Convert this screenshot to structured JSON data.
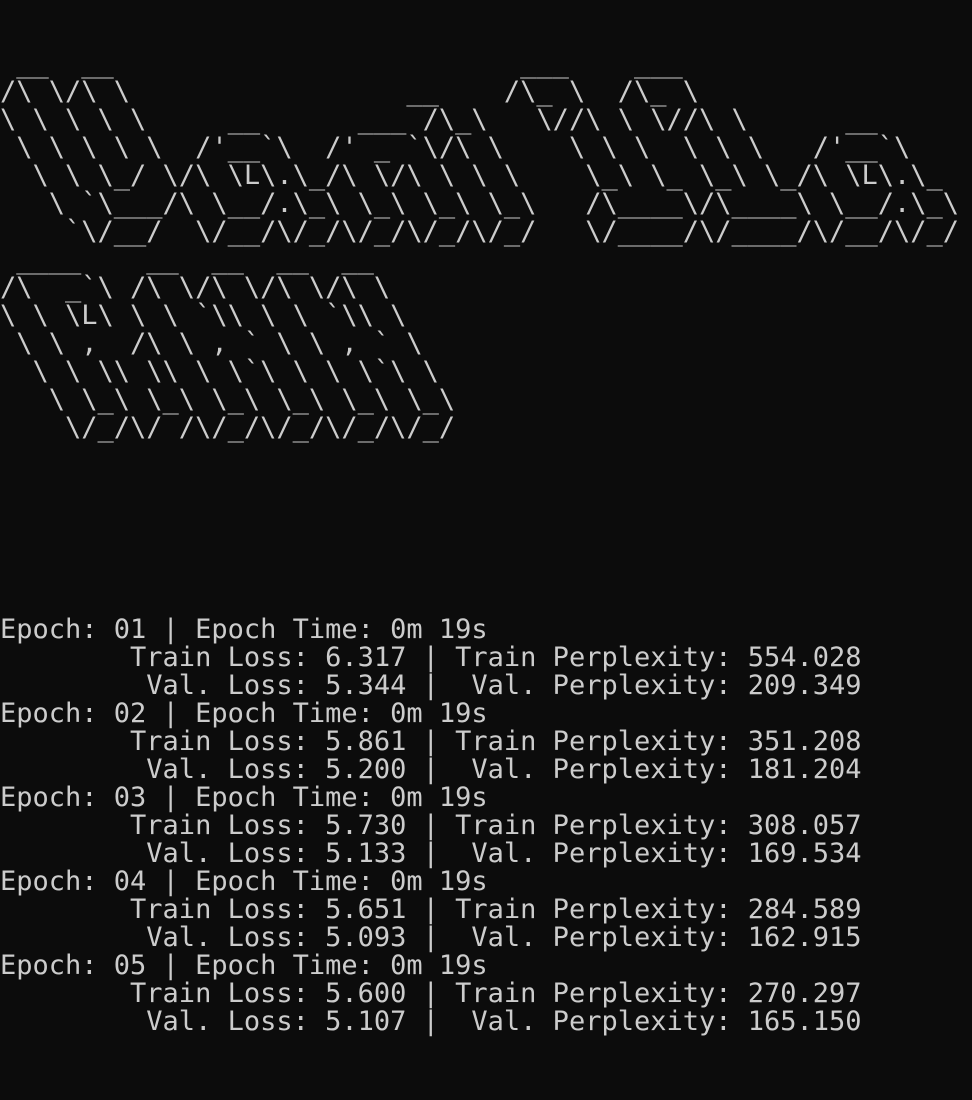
{
  "terminal": {
    "background": "#0c0c0c",
    "foreground": "#cccccc"
  },
  "banner": {
    "art": " __  __                         ___    ___              \n/\\ \\/\\ \\                 __    /\\_ \\  /\\_ \\             \n\\ \\ \\ \\ \\     __      ___ /\\_\\   \\//\\ \\ \\//\\ \\      __     \n \\ \\ \\ \\ \\  /'__`\\  /' _ `\\/\\ \\    \\ \\ \\  \\ \\ \\   /'__`\\   \n  \\ \\ \\_/ \\/\\ \\L\\.\\_/\\ \\/\\ \\ \\ \\    \\_\\ \\_ \\_\\ \\_/\\ \\L\\.\\_ \n   \\ `\\___/\\ \\__/.\\_\\ \\_\\ \\_\\ \\_\\   /\\____\\/\\____\\ \\__/.\\_\\\n    `\\/__/  \\/__/\\/_/\\/_/\\/_/\\/_/   \\/____/\\/____/\\/__/\\/_/\n ____    __  __  __  __ \n/\\  _`\\ /\\ \\/\\ \\/\\ \\/\\ \\\n\\ \\ \\L\\ \\ \\ `\\\\ \\ \\ `\\\\ \\\n \\ \\ ,  /\\ \\ , ` \\ \\ , ` \\\n  \\ \\ \\\\ \\\\ \\ \\`\\ \\ \\ \\`\\ \\\n   \\ \\_\\ \\_\\ \\_\\ \\_\\ \\_\\ \\_\\\n    \\/_/\\/ /\\/_/\\/_/\\/_/\\/_/"
  },
  "epochs": [
    {
      "epoch_line": "Epoch: 01 | Epoch Time: 0m 19s",
      "train_line": "        Train Loss: 6.317 | Train Perplexity: 554.028",
      "val_line": "         Val. Loss: 5.344 |  Val. Perplexity: 209.349"
    },
    {
      "epoch_line": "Epoch: 02 | Epoch Time: 0m 19s",
      "train_line": "        Train Loss: 5.861 | Train Perplexity: 351.208",
      "val_line": "         Val. Loss: 5.200 |  Val. Perplexity: 181.204"
    },
    {
      "epoch_line": "Epoch: 03 | Epoch Time: 0m 19s",
      "train_line": "        Train Loss: 5.730 | Train Perplexity: 308.057",
      "val_line": "         Val. Loss: 5.133 |  Val. Perplexity: 169.534"
    },
    {
      "epoch_line": "Epoch: 04 | Epoch Time: 0m 19s",
      "train_line": "        Train Loss: 5.651 | Train Perplexity: 284.589",
      "val_line": "         Val. Loss: 5.093 |  Val. Perplexity: 162.915"
    },
    {
      "epoch_line": "Epoch: 05 | Epoch Time: 0m 19s",
      "train_line": "        Train Loss: 5.600 | Train Perplexity: 270.297",
      "val_line": "         Val. Loss: 5.107 |  Val. Perplexity: 165.150"
    }
  ]
}
